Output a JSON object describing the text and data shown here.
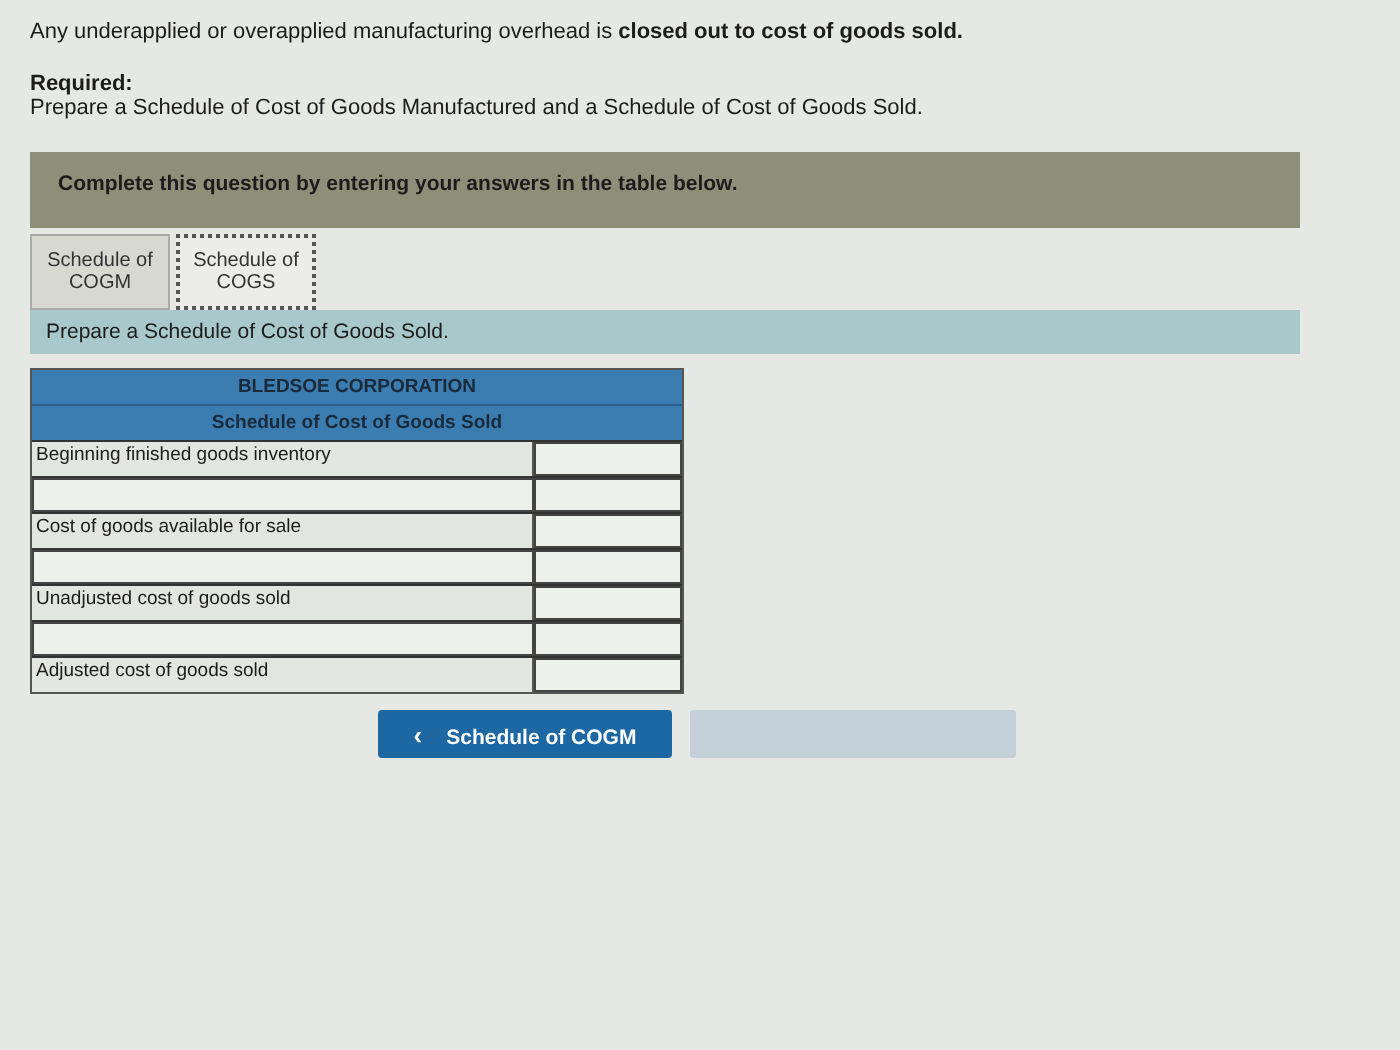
{
  "intro": "Any underapplied or overapplied manufacturing overhead is **closed out to cost of goods sold.**",
  "required": {
    "heading": "Required:",
    "text": "Prepare a Schedule of Cost of Goods Manufactured and a Schedule of Cost of Goods Sold."
  },
  "banner": "Complete this question by entering your answers in the table below.",
  "tabs": [
    {
      "label": "Schedule of COGM",
      "selected": false
    },
    {
      "label": "Schedule of COGS",
      "selected": true
    }
  ],
  "instruction": "Prepare a Schedule of Cost of Goods Sold.",
  "table": {
    "company": "BLEDSOE CORPORATION",
    "title": "Schedule of Cost of Goods Sold",
    "rows": [
      {
        "kind": "label",
        "label": "Beginning finished goods inventory"
      },
      {
        "kind": "entry"
      },
      {
        "kind": "label",
        "label": "Cost of goods available for sale"
      },
      {
        "kind": "entry"
      },
      {
        "kind": "label",
        "label": "Unadjusted cost of goods sold"
      },
      {
        "kind": "entry"
      },
      {
        "kind": "label",
        "label": "Adjusted cost of goods sold"
      }
    ]
  },
  "nav_buttons": [
    {
      "icon": "‹",
      "label": "Schedule of COGM",
      "disabled": false
    },
    {
      "disabled": true
    }
  ]
}
